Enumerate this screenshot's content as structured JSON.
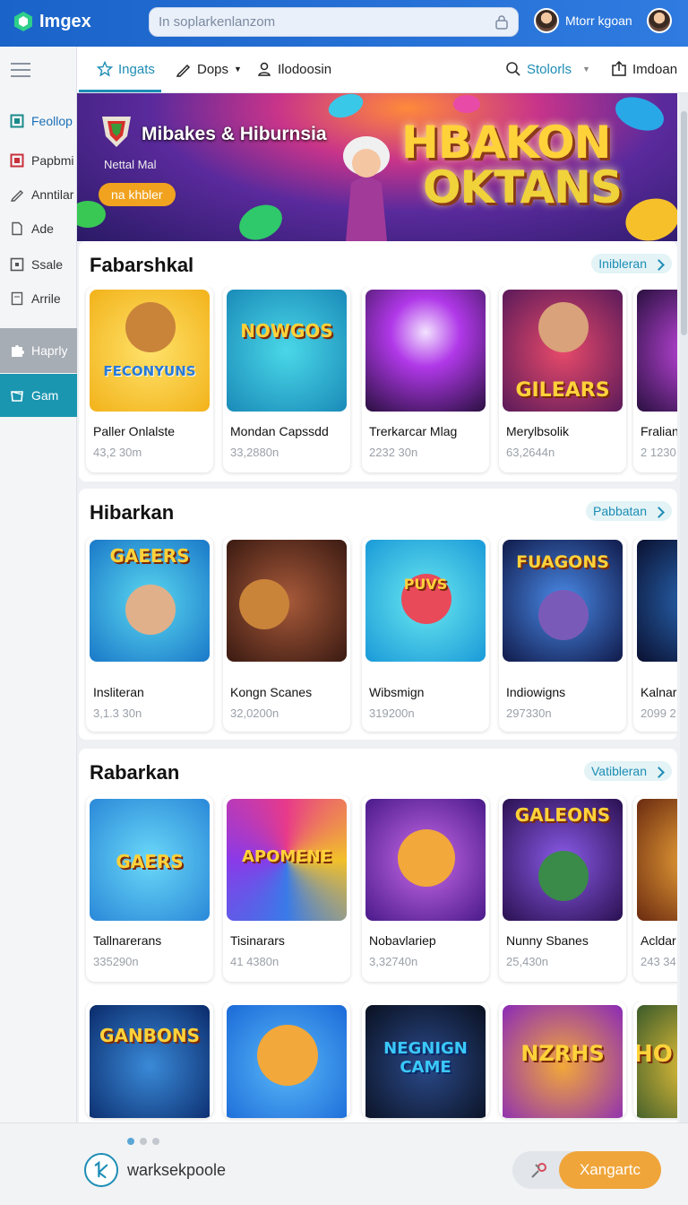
{
  "app": {
    "name": "Imgex",
    "logo_icon": "cube-logo-icon",
    "accent": "#1a63c9"
  },
  "search": {
    "value": "In soplarkenlanzom",
    "icon": "lock-icon"
  },
  "user": {
    "name": "Mtorr kgoan"
  },
  "sidebar": {
    "items": [
      {
        "label": "Feollop",
        "icon": "square-icon"
      },
      {
        "label": "Papbmi",
        "icon": "square-icon"
      },
      {
        "label": "Anntilar",
        "icon": "pen-icon"
      },
      {
        "label": "Ade",
        "icon": "doc-icon"
      },
      {
        "label": "Ssale",
        "icon": "square-icon"
      },
      {
        "label": "Arrile",
        "icon": "doc-icon"
      },
      {
        "label": "Haprly",
        "icon": "puzzle-icon"
      },
      {
        "label": "Gam",
        "icon": "box-icon"
      }
    ]
  },
  "tabs": [
    {
      "label": "Ingats",
      "icon": "star-icon"
    },
    {
      "label": "Dops",
      "icon": "pen-icon",
      "dropdown": true
    },
    {
      "label": "Ilodoosin",
      "icon": "lock-icon"
    },
    {
      "label": "Stolorls",
      "icon": "search-icon",
      "dropdown": true
    },
    {
      "label": "Imdoan",
      "icon": "export-icon"
    }
  ],
  "banner": {
    "title": "Mibakes & Hiburnsia",
    "subtitle": "Nettal Mal",
    "button": "na khbler",
    "headline_1": "HBAKON",
    "headline_2": "OKTANS"
  },
  "sections": [
    {
      "title": "Fabarshkal",
      "link": "Inibleran",
      "cards": [
        {
          "name": "Paller Onlalste",
          "count": "43,2 30m",
          "art_word": "FECONYUNS"
        },
        {
          "name": "Mondan Capssdd",
          "count": "33,2880n",
          "art_word": "NOWGOS"
        },
        {
          "name": "Trerkarcar Mlag",
          "count": "2232 30n",
          "art_word": ""
        },
        {
          "name": "Merylbsolik",
          "count": "63,2644n",
          "art_word": "GILEARS"
        },
        {
          "name": "Fralian",
          "count": "2 1230",
          "art_word": ""
        }
      ]
    },
    {
      "title": "Hibarkan",
      "link": "Pabbatan",
      "cards": [
        {
          "name": "Insliteran",
          "count": "3,1.3 30n",
          "art_word": "GAEERS"
        },
        {
          "name": "Kongn Scanes",
          "count": "32,0200n",
          "art_word": ""
        },
        {
          "name": "Wibsmign",
          "count": "319200n",
          "art_word": "PUVS"
        },
        {
          "name": "Indiowigns",
          "count": "297330n",
          "art_word": "FUAGONS"
        },
        {
          "name": "Kalnar",
          "count": "2099 2",
          "art_word": ""
        }
      ]
    },
    {
      "title": "Rabarkan",
      "link": "Vatibleran",
      "cards": [
        {
          "name": "Tallnarerans",
          "count": "335290n",
          "art_word": "GAERS"
        },
        {
          "name": "Tisinarars",
          "count": "41 4380n",
          "art_word": "APOMENE"
        },
        {
          "name": "Nobavlariep",
          "count": "3,32740n",
          "art_word": ""
        },
        {
          "name": "Nunny Sbanes",
          "count": "25,430n",
          "art_word": "GALEONS"
        },
        {
          "name": "Acldar",
          "count": "243 34",
          "art_word": ""
        }
      ],
      "more_cards": [
        {
          "art_word": "GANBONS"
        },
        {
          "art_word": ""
        },
        {
          "art_word": "NEGNIGN CAME"
        },
        {
          "art_word": "NZRHS"
        },
        {
          "art_word": "HO"
        }
      ]
    }
  ],
  "bottom": {
    "label": "warksekpoole",
    "button": "Xangartc",
    "icon": "back-arrow-icon",
    "button_color": "#f0a53a"
  }
}
